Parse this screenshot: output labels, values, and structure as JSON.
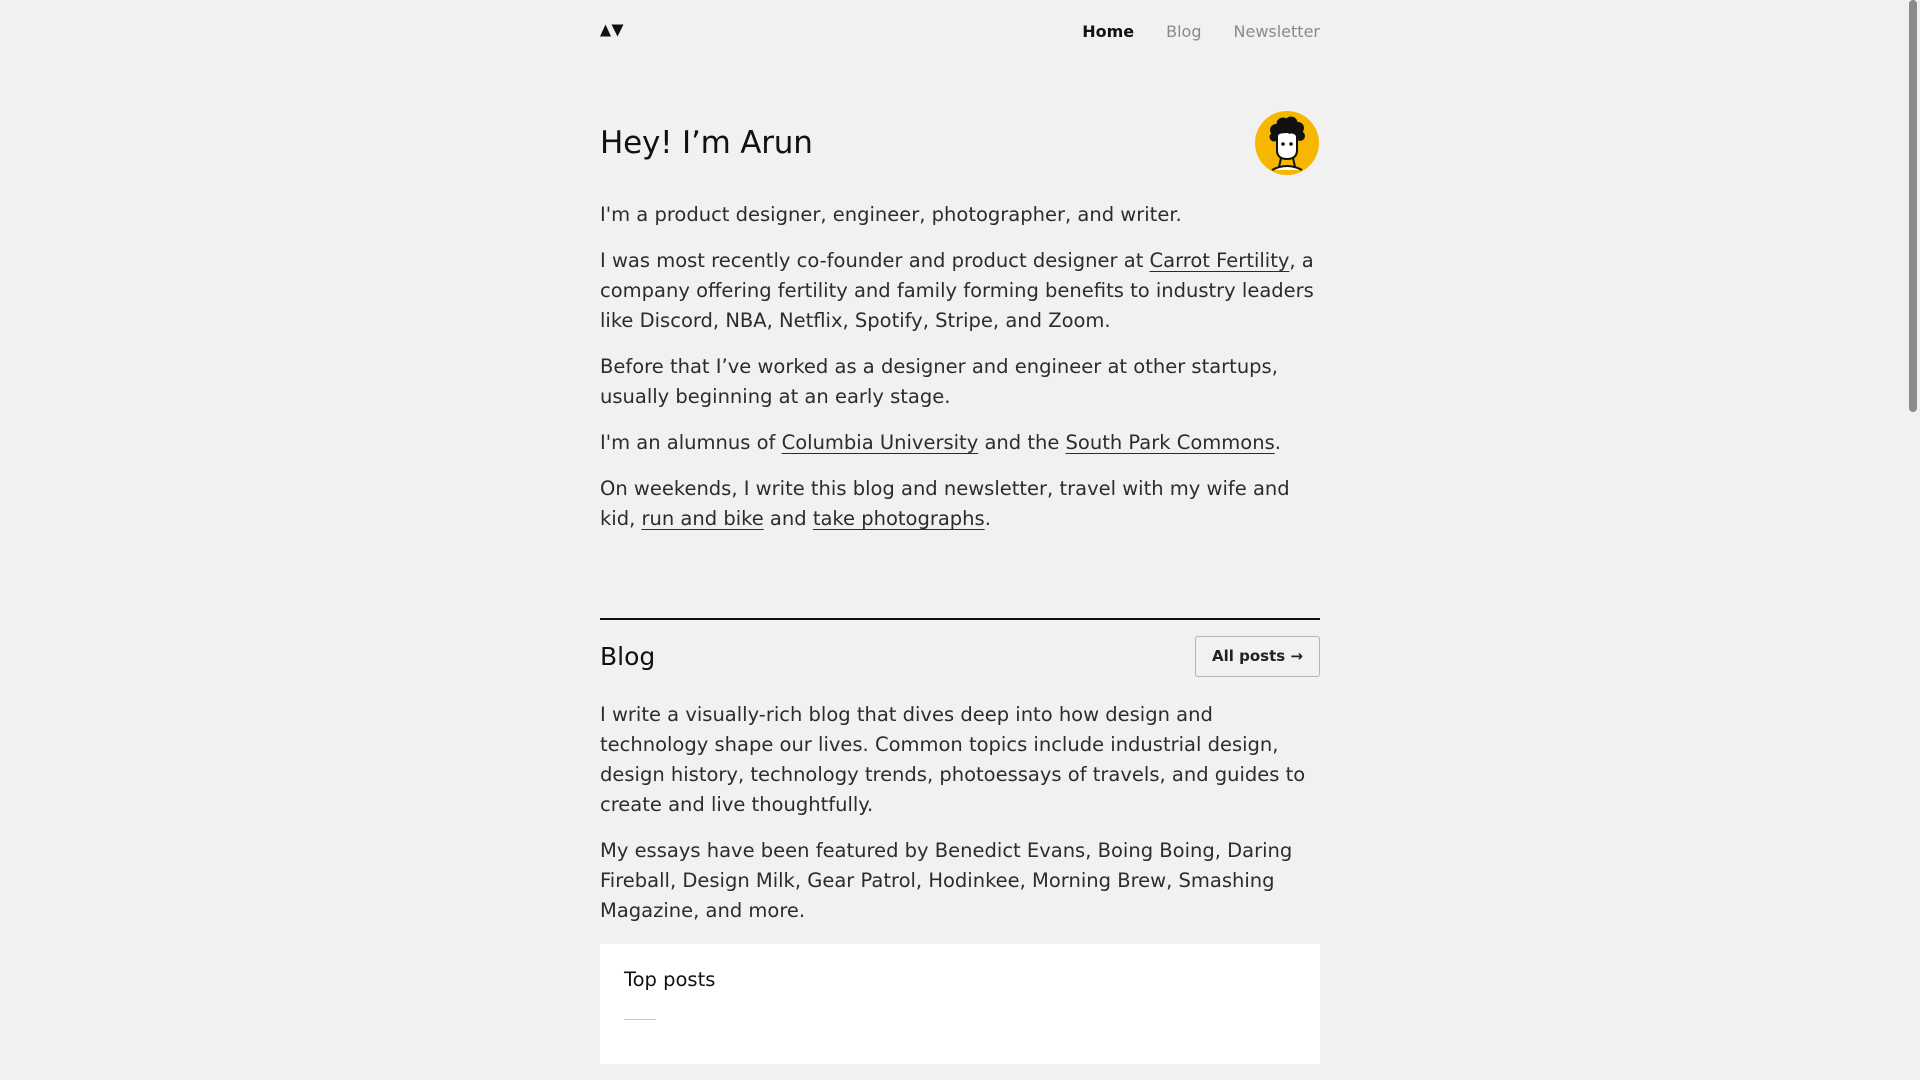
{
  "nav": {
    "logo_icon": "brand-logo-triangles",
    "items": [
      {
        "label": "Home",
        "active": true
      },
      {
        "label": "Blog",
        "active": false
      },
      {
        "label": "Newsletter",
        "active": false
      }
    ]
  },
  "hero": {
    "title": "Hey! I’m Arun",
    "avatar_icon": "avatar-illustration",
    "avatar_color": "#f6b700"
  },
  "intro": {
    "p1": "I'm a product designer, engineer, photographer, and writer.",
    "p2_before": "I was most recently co-founder and product designer at ",
    "p2_link": "Carrot Fertility",
    "p2_after": ", a company offering fertility and family forming benefits to industry leaders like Discord, NBA, Netflix, Spotify, Stripe, and Zoom.",
    "p3": "Before that I’ve worked as a designer and engineer at other startups, usually beginning at an early stage.",
    "p4_before": "I'm an alumnus of ",
    "p4_link1": "Columbia University",
    "p4_mid": " and the ",
    "p4_link2": "South Park Commons",
    "p4_after": ".",
    "p5_before": "On weekends, I write this blog and newsletter, travel with my wife and kid, ",
    "p5_link1": "run and bike",
    "p5_mid": " and ",
    "p5_link2": "take photographs",
    "p5_after": "."
  },
  "blog": {
    "heading": "Blog",
    "all_posts_label": "All posts →",
    "p1": "I write a visually-rich blog that dives deep into how design and technology shape our lives. Common topics include industrial design, design history, technology trends, photoessays of travels, and guides to create and live thoughtfully.",
    "p2": "My essays have been featured by Benedict Evans, Boing Boing, Daring Fireball, Design Milk, Gear Patrol, Hodinkee, Morning Brew, Smashing Magazine, and more.",
    "top_posts_title": "Top posts"
  }
}
